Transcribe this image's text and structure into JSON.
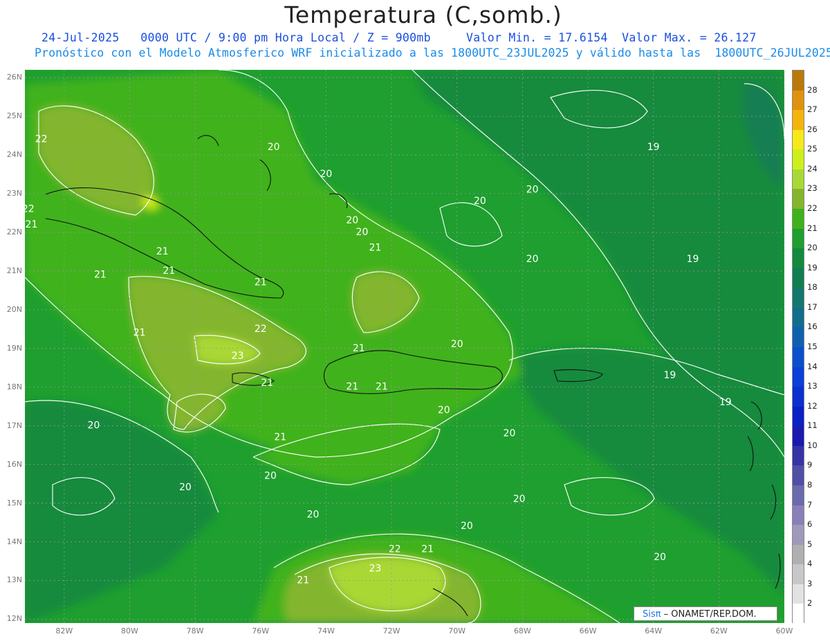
{
  "title": "Temperatura (C,somb.)",
  "subtitle_1": "24-Jul-2025   0000 UTC / 9:00 pm Hora Local / Z = 900mb     Valor Min. = 17.6154  Valor Max. = 26.127",
  "subtitle_2": "Pronóstico con el Modelo Atmosferico WRF inicializado a las 1800UTC_23JUL2025 y válido hasta las  1800UTC_26JUL2025",
  "credit": {
    "brand": "Sisπ",
    "text": "– ONAMET/REP.DOM."
  },
  "lat_labels": [
    "26N",
    "25N",
    "24N",
    "23N",
    "22N",
    "21N",
    "20N",
    "19N",
    "18N",
    "17N",
    "16N",
    "15N",
    "14N",
    "13N",
    "12N"
  ],
  "lon_labels": [
    "82W",
    "80W",
    "78W",
    "76W",
    "74W",
    "72W",
    "70W",
    "68W",
    "66W",
    "64W",
    "62W",
    "60W"
  ],
  "colorbar": {
    "labels": [
      "28",
      "27",
      "26",
      "25",
      "24",
      "23",
      "22",
      "21",
      "20",
      "19",
      "18",
      "17",
      "16",
      "15",
      "14",
      "13",
      "12",
      "11",
      "10",
      "9",
      "8",
      "7",
      "6",
      "5",
      "4",
      "3",
      "2"
    ],
    "colors": [
      "#b97a0a",
      "#e0920e",
      "#f3b40c",
      "#f8e81a",
      "#cdf01a",
      "#a9d836",
      "#83b62e",
      "#3fb21b",
      "#1e9f2f",
      "#138a3d",
      "#127e52",
      "#13786e",
      "#116e8c",
      "#0f61b0",
      "#0b4fcc",
      "#0a3fd8",
      "#0a30d0",
      "#0a22c4",
      "#1a1ab0",
      "#3434a8",
      "#4f4fa6",
      "#6a6aad",
      "#8a7fb8",
      "#9e9aba",
      "#b0b0b0",
      "#c8c8c8",
      "#e2e2e2",
      "#ffffff"
    ]
  },
  "contour_labels": [
    {
      "text": "22",
      "lon": -82.7,
      "lat": 24.4
    },
    {
      "text": "22",
      "lon": -83.1,
      "lat": 22.6
    },
    {
      "text": "21",
      "lon": -83.0,
      "lat": 22.2
    },
    {
      "text": "21",
      "lon": -80.9,
      "lat": 20.9
    },
    {
      "text": "21",
      "lon": -79.0,
      "lat": 21.5
    },
    {
      "text": "21",
      "lon": -78.8,
      "lat": 21.0
    },
    {
      "text": "21",
      "lon": -79.7,
      "lat": 19.4
    },
    {
      "text": "22",
      "lon": -76.0,
      "lat": 19.5
    },
    {
      "text": "23",
      "lon": -76.7,
      "lat": 18.8
    },
    {
      "text": "21",
      "lon": -75.8,
      "lat": 18.1
    },
    {
      "text": "20",
      "lon": -81.1,
      "lat": 17.0
    },
    {
      "text": "21",
      "lon": -75.4,
      "lat": 16.7
    },
    {
      "text": "20",
      "lon": -78.3,
      "lat": 15.4
    },
    {
      "text": "20",
      "lon": -75.7,
      "lat": 15.7
    },
    {
      "text": "20",
      "lon": -74.4,
      "lat": 14.7
    },
    {
      "text": "21",
      "lon": -74.7,
      "lat": 13.0
    },
    {
      "text": "23",
      "lon": -72.5,
      "lat": 13.3
    },
    {
      "text": "22",
      "lon": -71.9,
      "lat": 13.8
    },
    {
      "text": "21",
      "lon": -70.9,
      "lat": 13.8
    },
    {
      "text": "20",
      "lon": -75.6,
      "lat": 24.2
    },
    {
      "text": "20",
      "lon": -74.0,
      "lat": 23.5
    },
    {
      "text": "20",
      "lon": -73.2,
      "lat": 22.3
    },
    {
      "text": "21",
      "lon": -72.5,
      "lat": 21.6
    },
    {
      "text": "20",
      "lon": -72.9,
      "lat": 22.0
    },
    {
      "text": "21",
      "lon": -76.0,
      "lat": 20.7
    },
    {
      "text": "21",
      "lon": -73.0,
      "lat": 19.0
    },
    {
      "text": "21",
      "lon": -73.2,
      "lat": 18.0
    },
    {
      "text": "21",
      "lon": -72.3,
      "lat": 18.0
    },
    {
      "text": "20",
      "lon": -70.0,
      "lat": 19.1
    },
    {
      "text": "20",
      "lon": -70.4,
      "lat": 17.4
    },
    {
      "text": "20",
      "lon": -68.4,
      "lat": 16.8
    },
    {
      "text": "20",
      "lon": -69.7,
      "lat": 14.4
    },
    {
      "text": "20",
      "lon": -68.1,
      "lat": 15.1
    },
    {
      "text": "20",
      "lon": -69.3,
      "lat": 22.8
    },
    {
      "text": "20",
      "lon": -67.7,
      "lat": 23.1
    },
    {
      "text": "20",
      "lon": -67.7,
      "lat": 21.3
    },
    {
      "text": "19",
      "lon": -64.0,
      "lat": 24.2
    },
    {
      "text": "19",
      "lon": -62.8,
      "lat": 21.3
    },
    {
      "text": "19",
      "lon": -63.5,
      "lat": 18.3
    },
    {
      "text": "19",
      "lon": -61.8,
      "lat": 17.6
    },
    {
      "text": "20",
      "lon": -63.8,
      "lat": 13.6
    }
  ]
}
